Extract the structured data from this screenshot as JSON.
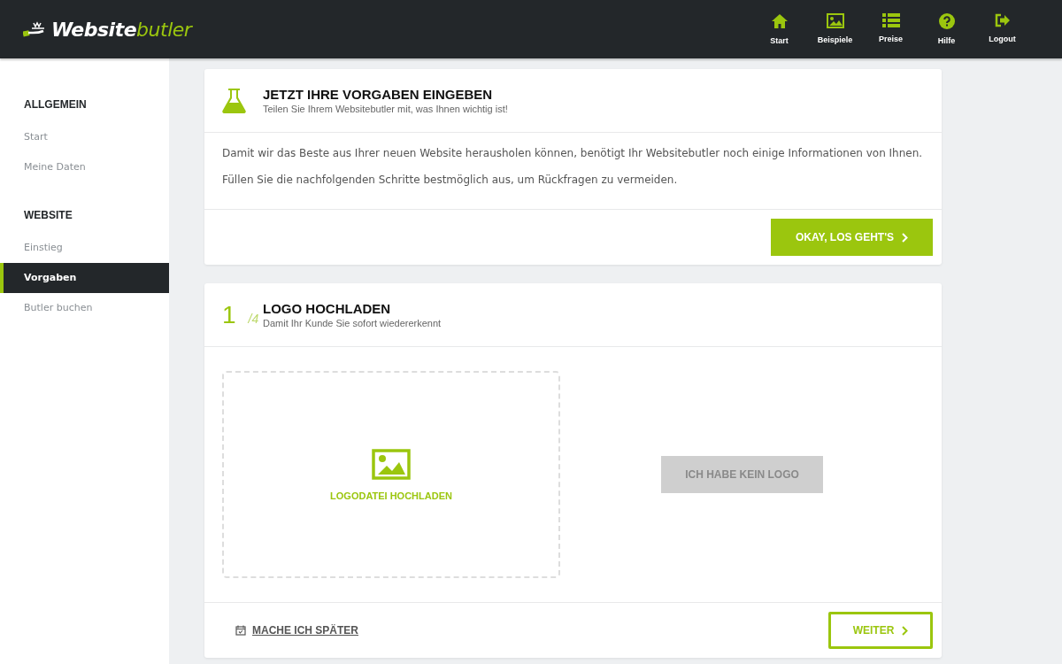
{
  "logo": {
    "text": "Website",
    "accent": "butler"
  },
  "top_nav": [
    {
      "label": "Start",
      "kind": "home"
    },
    {
      "label": "Beispiele",
      "kind": "image"
    },
    {
      "label": "Preise",
      "kind": "list"
    },
    {
      "label": "Hilfe",
      "kind": "help"
    },
    {
      "label": "Logout",
      "kind": "logout"
    }
  ],
  "sidebar": {
    "sections": [
      {
        "heading": "ALLGEMEIN",
        "items": [
          {
            "label": "Start",
            "selected": false
          },
          {
            "label": "Meine Daten",
            "selected": false
          }
        ]
      },
      {
        "heading": "WEBSITE",
        "items": [
          {
            "label": "Einstieg",
            "selected": false
          },
          {
            "label": "Vorgaben",
            "selected": true
          },
          {
            "label": "Butler buchen",
            "selected": false
          }
        ]
      }
    ]
  },
  "intro_card": {
    "title": "JETZT IHRE VORGABEN EINGEBEN",
    "subtitle": "Teilen Sie Ihrem Websitebutler mit, was Ihnen wichtig ist!",
    "paragraphs": [
      "Damit wir das Beste aus Ihrer neuen Website herausholen können, benötigt Ihr Websitebutler noch einige Informationen von Ihnen.",
      "Füllen Sie die nachfolgenden Schritte bestmöglich aus, um Rückfragen zu vermeiden."
    ],
    "button": "OKAY, LOS GEHT'S"
  },
  "step_card": {
    "step": "1",
    "total": "/4",
    "title": "LOGO HOCHLADEN",
    "subtitle": "Damit Ihr Kunde Sie sofort wiedererkennt",
    "upload_label": "LOGODATEI HOCHLADEN",
    "no_logo_button": {
      "label": "ICH HABE KEIN LOGO",
      "disabled": true
    },
    "later_link": "MACHE ICH SPÄTER",
    "next_button": "WEITER"
  }
}
